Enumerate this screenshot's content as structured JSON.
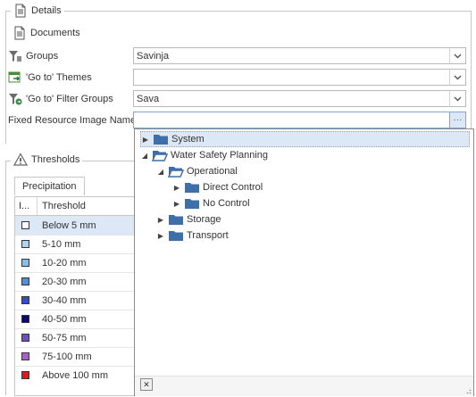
{
  "details": {
    "header_label": "Details",
    "documents_label": "Documents",
    "groups_label": "Groups",
    "groups_value": "Savinja",
    "goto_themes_label": "'Go to' Themes",
    "goto_themes_value": "",
    "goto_filter_groups_label": "'Go to' Filter Groups",
    "goto_filter_groups_value": "Sava",
    "fixed_image_label": "Fixed Resource Image Name",
    "fixed_image_value": "",
    "ellipsis_label": "···"
  },
  "thresholds": {
    "header_label": "Thresholds",
    "tab_label": "Precipitation",
    "columns": [
      "I...",
      "Threshold"
    ],
    "rows": [
      {
        "label": "Below 5 mm",
        "color": "#ffffff"
      },
      {
        "label": "5-10 mm",
        "color": "#a9d4f0"
      },
      {
        "label": "10-20 mm",
        "color": "#7fc0ef"
      },
      {
        "label": "20-30 mm",
        "color": "#4f8fdc"
      },
      {
        "label": "30-40 mm",
        "color": "#2e4fd0"
      },
      {
        "label": "40-50 mm",
        "color": "#0a0a7a"
      },
      {
        "label": "50-75 mm",
        "color": "#6a4fc8"
      },
      {
        "label": "75-100 mm",
        "color": "#b05ad6"
      },
      {
        "label": "Above 100 mm",
        "color": "#e8141b"
      }
    ]
  },
  "tree_popup": {
    "items": [
      {
        "label": "System",
        "level": 0,
        "expanded": false,
        "selected": true
      },
      {
        "label": "Water Safety Planning",
        "level": 0,
        "expanded": true,
        "selected": false
      },
      {
        "label": "Operational",
        "level": 1,
        "expanded": true,
        "selected": false
      },
      {
        "label": "Direct Control",
        "level": 2,
        "expanded": false,
        "selected": false
      },
      {
        "label": "No Control",
        "level": 2,
        "expanded": false,
        "selected": false
      },
      {
        "label": "Storage",
        "level": 1,
        "expanded": false,
        "selected": false
      },
      {
        "label": "Transport",
        "level": 1,
        "expanded": false,
        "selected": false
      }
    ],
    "close_label": "✕"
  },
  "colors": {
    "accent_folder": "#3f6fa8",
    "selection_bg": "#dce8f5",
    "selected_row_bg": "#dce8f5"
  }
}
